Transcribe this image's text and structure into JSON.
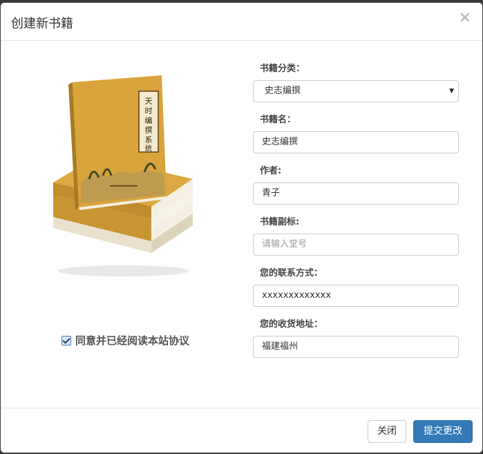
{
  "modal": {
    "title": "创建新书籍",
    "close_symbol": "×"
  },
  "cover": {
    "spine_title": "天时编撰系统",
    "colors": {
      "cover": "#d9a43b",
      "cover_dark": "#b8862a",
      "pages": "#f4efe2"
    }
  },
  "form": {
    "category": {
      "label": "书籍分类：",
      "value": "史志编撰"
    },
    "name": {
      "label": "书籍名：",
      "value": "史志编撰"
    },
    "author": {
      "label": "作者:",
      "value": "青子"
    },
    "subtitle": {
      "label": "书籍副标:",
      "placeholder": "请输入堂号"
    },
    "contact": {
      "label": "您的联系方式：",
      "value": "xxxxxxxxxxxxx"
    },
    "address": {
      "label": "您的收货地址：",
      "value": "福建福州"
    }
  },
  "agreement": {
    "label": "同意并已经阅读本站协议",
    "checked": true
  },
  "footer": {
    "close_label": "关闭",
    "submit_label": "提交更改"
  },
  "colors": {
    "primary": "#337ab7",
    "border": "#cccccc"
  }
}
